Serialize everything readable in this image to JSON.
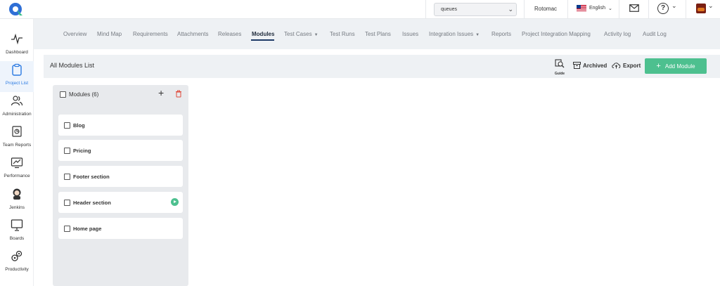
{
  "topbar": {
    "project_select": "queues",
    "org_name": "Rotomac",
    "language": "English"
  },
  "sidebar": {
    "items": [
      {
        "label": "Dashboard",
        "icon": "pulse-icon"
      },
      {
        "label": "Project List",
        "icon": "clipboard-icon",
        "active": true
      },
      {
        "label": "Administration",
        "icon": "users-icon"
      },
      {
        "label": "Team Reports",
        "icon": "report-icon"
      },
      {
        "label": "Performance",
        "icon": "chart-icon"
      },
      {
        "label": "Jenkins",
        "icon": "jenkins-icon"
      },
      {
        "label": "Boards",
        "icon": "board-icon"
      },
      {
        "label": "Productivity",
        "icon": "gears-icon"
      }
    ]
  },
  "nav": {
    "tabs": [
      "Overview",
      "Mind Map",
      "Requirements",
      "Attachments",
      "Releases",
      "Modules",
      "Test Cases",
      "Test Runs",
      "Test Plans",
      "Issues",
      "Integration Issues",
      "Reports",
      "Project Integration Mapping",
      "Activity log",
      "Audit Log"
    ],
    "active": "Modules"
  },
  "header": {
    "title": "All Modules List",
    "guide_label": "Guide",
    "archived_label": "Archived",
    "export_label": "Export",
    "add_module_label": "Add Module"
  },
  "modules": {
    "header_label": "Modules (6)",
    "items": [
      "Blog",
      "Pricing",
      "Footer section",
      "Header section",
      "Home page"
    ]
  },
  "colors": {
    "accent_green": "#4dc08f",
    "active_blue": "#2a7ae2",
    "trash_red": "#e04b3c"
  }
}
